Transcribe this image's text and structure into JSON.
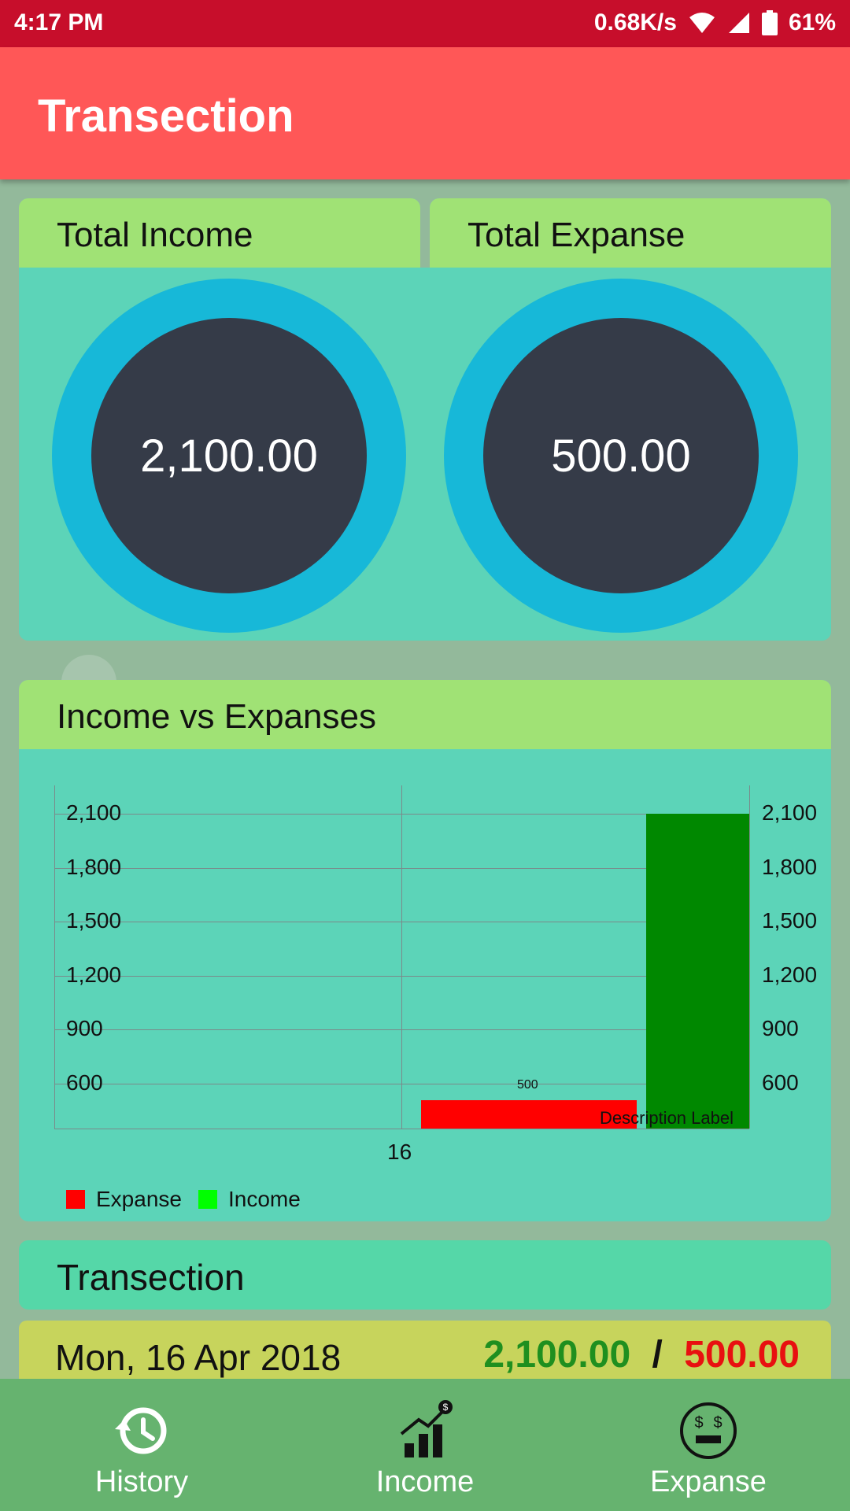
{
  "status_bar": {
    "time": "4:17 PM",
    "speed": "0.68K/s",
    "battery": "61%"
  },
  "app_bar": {
    "title": "Transection"
  },
  "summary": {
    "income_header": "Total Income",
    "income_value": "2,100.00",
    "expense_header": "Total Expanse",
    "expense_value": "500.00"
  },
  "chart_card": {
    "header": "Income vs Expanses"
  },
  "chart_data": {
    "type": "bar",
    "categories": [
      "16"
    ],
    "series": [
      {
        "name": "Expanse",
        "values": [
          500
        ],
        "color": "#ff0000"
      },
      {
        "name": "Income",
        "values": [
          2100
        ],
        "color": "#008800"
      }
    ],
    "legend_colors": {
      "Expanse": "#ff0000",
      "Income": "#00ff00"
    },
    "y_ticks_left": [
      "2,100",
      "1,800",
      "1,500",
      "1,200",
      "900",
      "600"
    ],
    "y_ticks_right": [
      "2,100",
      "1,800",
      "1,500",
      "1,200",
      "900",
      "600"
    ],
    "x_ticks": [
      "16"
    ],
    "ylim": [
      500,
      2100
    ],
    "value_label": "500",
    "description": "Description Label",
    "legend_position": "bottom-left"
  },
  "transaction_section": {
    "header": "Transection",
    "row_date": "Mon, 16 Apr 2018",
    "row_income": "2,100.00",
    "row_separator": "/",
    "row_expense": "500.00",
    "income_color": "#1f8f1f",
    "expense_color": "#e81010"
  },
  "bottom_nav": {
    "items": [
      {
        "label": "History",
        "icon": "history-icon"
      },
      {
        "label": "Income",
        "icon": "income-chart-icon"
      },
      {
        "label": "Expanse",
        "icon": "expense-money-icon"
      }
    ]
  }
}
